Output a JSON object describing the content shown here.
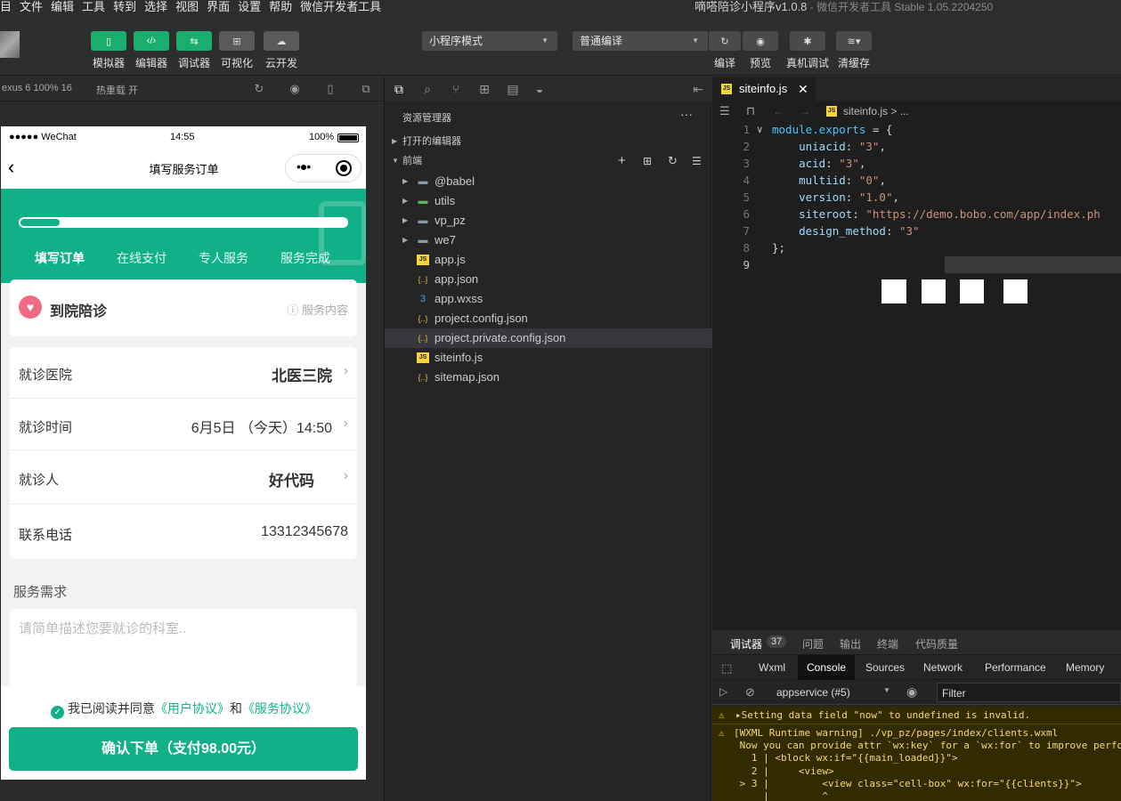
{
  "menu": [
    "项目",
    "文件",
    "编辑",
    "工具",
    "转到",
    "选择",
    "视图",
    "界面",
    "设置",
    "帮助",
    "微信开发者工具"
  ],
  "window_title": "嘀嗒陪诊小程序v1.0.8",
  "window_subtitle": " - 微信开发者工具 Stable 1.05.2204250",
  "toolbar": {
    "left_buttons": [
      {
        "label": "模拟器",
        "icon": "phone-icon"
      },
      {
        "label": "编辑器",
        "icon": "code-icon"
      },
      {
        "label": "调试器",
        "icon": "debug-icon"
      },
      {
        "label": "可视化",
        "icon": "layout-icon"
      },
      {
        "label": "云开发",
        "icon": "cloud-icon"
      }
    ],
    "mode_select": "小程序模式",
    "compile_select": "普通编译",
    "right_buttons": [
      "编译",
      "预览",
      "真机调试",
      "清缓存"
    ]
  },
  "simulator": {
    "device": "exus 6 100% 16",
    "hot_reload": "热重载 开",
    "status": {
      "carrier": "●●●●● WeChat",
      "time": "14:55",
      "battery": "100%"
    },
    "nav_title": "填写服务订单",
    "steps": [
      "填写订单",
      "在线支付",
      "专人服务",
      "服务完成"
    ],
    "progress": 0.12,
    "service": {
      "name": "到院陪诊",
      "link": "服务内容"
    },
    "rows": [
      {
        "label": "就诊医院",
        "value": "北医三院"
      },
      {
        "label": "就诊时间",
        "value": "6月5日 （今天）14:50"
      },
      {
        "label": "就诊人",
        "value": "好代码"
      },
      {
        "label": "联系电话",
        "value": "13312345678"
      }
    ],
    "needs_label": "服务需求",
    "needs_placeholder": "请简单描述您要就诊的科室..",
    "agreement": {
      "prefix": "我已阅读并同意",
      "link1": "《用户协议》",
      "and": "和",
      "link2": "《服务协议》"
    },
    "submit": "确认下单（支付98.00元）"
  },
  "explorer": {
    "title": "资源管理器",
    "open_editors": "打开的编辑器",
    "project": "前端",
    "items": [
      {
        "name": "@babel",
        "type": "folder"
      },
      {
        "name": "utils",
        "type": "folder-green"
      },
      {
        "name": "vp_pz",
        "type": "folder"
      },
      {
        "name": "we7",
        "type": "folder"
      },
      {
        "name": "app.js",
        "type": "js"
      },
      {
        "name": "app.json",
        "type": "json"
      },
      {
        "name": "app.wxss",
        "type": "css"
      },
      {
        "name": "project.config.json",
        "type": "json"
      },
      {
        "name": "project.private.config.json",
        "type": "json"
      },
      {
        "name": "siteinfo.js",
        "type": "js"
      },
      {
        "name": "sitemap.json",
        "type": "json"
      }
    ],
    "selected": "project.private.config.json"
  },
  "editor": {
    "tab": "siteinfo.js",
    "breadcrumb": "siteinfo.js > ...",
    "lines": [
      {
        "n": "1",
        "code": "module.exports = {"
      },
      {
        "n": "2",
        "code": "    uniacid: \"3\","
      },
      {
        "n": "3",
        "code": "    acid: \"3\","
      },
      {
        "n": "4",
        "code": "    multiid: \"0\","
      },
      {
        "n": "5",
        "code": "    version: \"1.0\","
      },
      {
        "n": "6",
        "code": "    siteroot: \"https://demo.bobo.com/app/index.ph"
      },
      {
        "n": "7",
        "code": "    design_method: \"3\""
      },
      {
        "n": "8",
        "code": "};"
      },
      {
        "n": "9",
        "code": ""
      }
    ]
  },
  "devtools": {
    "top_tabs": [
      "调试器",
      "37",
      "问题",
      "输出",
      "终端",
      "代码质量"
    ],
    "tabs": [
      "Wxml",
      "Console",
      "Sources",
      "Network",
      "Performance",
      "Memory"
    ],
    "active_tab": "Console",
    "context": "appservice (#5)",
    "filter_placeholder": "Filter",
    "messages": [
      "▸Setting data field \"now\" to undefined is invalid.",
      "[WXML Runtime warning] ./vp_pz/pages/index/clients.wxml\n Now you can provide attr `wx:key` for a `wx:for` to improve perfo\n   1 | <block wx:if=\"{{main_loaded}}\">\n   2 |     <view>\n > 3 |         <view class=\"cell-box\" wx:for=\"{{clients}}\">\n     |         ^"
    ]
  },
  "colors": {
    "accent": "#1aad6e",
    "hero": "#12b088",
    "warning_bg": "#332b00"
  }
}
